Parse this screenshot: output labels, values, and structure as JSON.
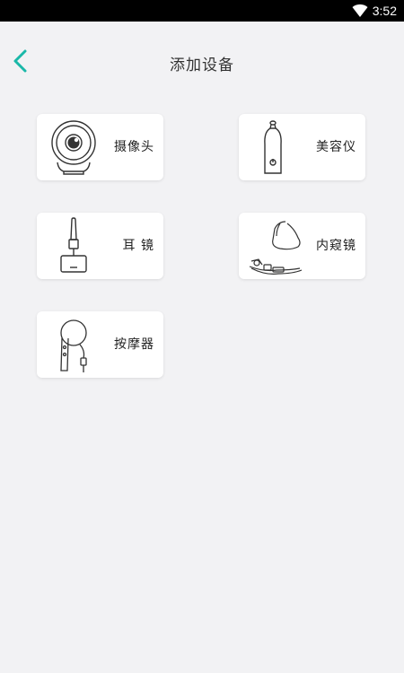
{
  "status_bar": {
    "time": "3:52",
    "icons": [
      "wifi-icon"
    ]
  },
  "header": {
    "title": "添加设备",
    "back_icon": "chevron-left-icon"
  },
  "accent_color": "#1ab8a8",
  "devices": [
    {
      "label": "摄像头",
      "icon": "camera-icon"
    },
    {
      "label": "美容仪",
      "icon": "beauty-device-icon"
    },
    {
      "label": "耳 镜",
      "icon": "otoscope-icon"
    },
    {
      "label": "内窥镜",
      "icon": "endoscope-icon"
    },
    {
      "label": "按摩器",
      "icon": "massager-icon"
    }
  ]
}
